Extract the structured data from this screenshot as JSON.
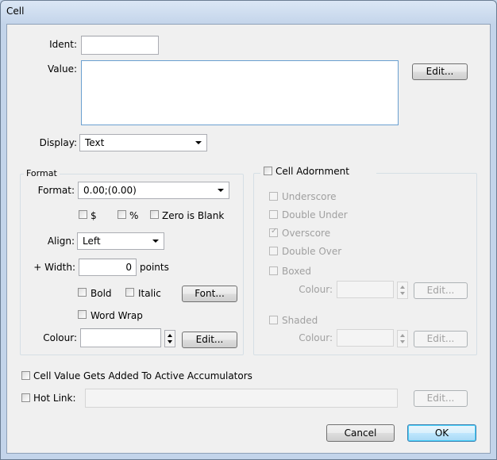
{
  "window": {
    "title": "Cell"
  },
  "main": {
    "ident_label": "Ident:",
    "ident_value": "",
    "value_label": "Value:",
    "value_text": "",
    "value_edit_button": "Edit...",
    "display_label": "Display:",
    "display_selected": "Text"
  },
  "format_group": {
    "caption": "Format",
    "format_label": "Format:",
    "format_selected": "0.00;(0.00)",
    "dollar_label": "$",
    "dollar_checked": false,
    "percent_label": "%",
    "percent_checked": false,
    "zero_blank_label": "Zero is Blank",
    "zero_blank_checked": false,
    "align_label": "Align:",
    "align_selected": "Left",
    "width_label": "+ Width:",
    "width_value": "0",
    "width_units": "points",
    "bold_label": "Bold",
    "italic_label": "Italic",
    "font_button": "Font...",
    "word_wrap_label": "Word Wrap",
    "colour_label": "Colour:",
    "colour_value": "",
    "colour_edit_button": "Edit..."
  },
  "adornment_group": {
    "caption": "Cell Adornment",
    "underscore_label": "Underscore",
    "double_under_label": "Double Under",
    "overscore_label": "Overscore",
    "overscore_checked": true,
    "double_over_label": "Double Over",
    "boxed_label": "Boxed",
    "boxed_colour_label": "Colour:",
    "boxed_edit_button": "Edit...",
    "shaded_label": "Shaded",
    "shaded_colour_label": "Colour:",
    "shaded_edit_button": "Edit..."
  },
  "footer": {
    "accumulators_label": "Cell Value Gets Added To Active Accumulators",
    "hot_link_label": "Hot Link:",
    "hot_link_value": "",
    "hot_link_edit_button": "Edit...",
    "cancel_button": "Cancel",
    "ok_button": "OK"
  },
  "icons": {
    "dropdown": "chevron-down-icon",
    "spinner": "spinner-icon",
    "checkmark": "checkmark-icon"
  }
}
